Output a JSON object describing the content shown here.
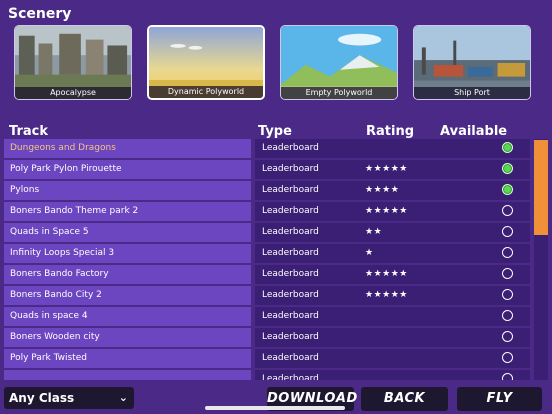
{
  "scenery": {
    "title": "Scenery",
    "items": [
      {
        "label": "Apocalypse",
        "selected": false
      },
      {
        "label": "Dynamic Polyworld",
        "selected": true
      },
      {
        "label": "Empty Polyworld",
        "selected": false
      },
      {
        "label": "Ship Port",
        "selected": false
      }
    ]
  },
  "columns": {
    "track": "Track",
    "type": "Type",
    "rating": "Rating",
    "offline": "Available Offline"
  },
  "tracks": [
    {
      "name": "Dungeons and Dragons",
      "type": "Leaderboard",
      "rating": "",
      "offline": true,
      "highlight": true
    },
    {
      "name": "Poly Park Pylon Pirouette",
      "type": "Leaderboard",
      "rating": "★★★★★",
      "offline": true
    },
    {
      "name": "Pylons",
      "type": "Leaderboard",
      "rating": "★★★★",
      "offline": true
    },
    {
      "name": "Boners Bando Theme park 2",
      "type": "Leaderboard",
      "rating": "★★★★★",
      "offline": false
    },
    {
      "name": "Quads in Space 5",
      "type": "Leaderboard",
      "rating": "★★",
      "offline": false
    },
    {
      "name": "Infinity Loops Special 3",
      "type": "Leaderboard",
      "rating": "★",
      "offline": false
    },
    {
      "name": "Boners Bando Factory",
      "type": "Leaderboard",
      "rating": "★★★★★",
      "offline": false
    },
    {
      "name": "Boners Bando City 2",
      "type": "Leaderboard",
      "rating": "★★★★★",
      "offline": false
    },
    {
      "name": "Quads in space 4",
      "type": "Leaderboard",
      "rating": "",
      "offline": false
    },
    {
      "name": "Boners Wooden city",
      "type": "Leaderboard",
      "rating": "",
      "offline": false
    },
    {
      "name": "Poly Park Twisted",
      "type": "Leaderboard",
      "rating": "",
      "offline": false
    },
    {
      "name": "",
      "type": "Leaderboard",
      "rating": "",
      "offline": false
    }
  ],
  "bottom_bar": {
    "class_select": "Any Class",
    "download": "DOWNLOAD",
    "back": "BACK",
    "fly": "FLY"
  },
  "colors": {
    "accent": "#f0913a",
    "online": "#5fd35a",
    "background": "#4a2a86"
  }
}
